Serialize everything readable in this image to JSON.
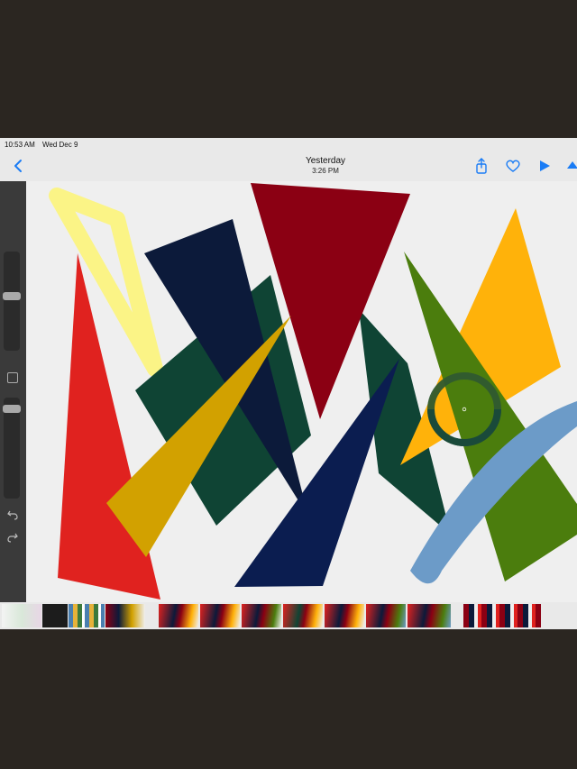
{
  "status_bar": {
    "time": "10:53 AM",
    "date": "Wed Dec 9"
  },
  "nav": {
    "title": "Yesterday",
    "subtitle": "3:26 PM",
    "icons": [
      "chevron-left-icon",
      "share-icon",
      "heart-icon",
      "play-icon",
      "procreate-icon"
    ],
    "accent_color": "#1a7cf5"
  },
  "artwork_colors": {
    "red": "#e0221f",
    "pale_yellow": "#fbf486",
    "navy": "#0c1a3a",
    "dark_green": "#0f4434",
    "crimson": "#8b0013",
    "gold": "#d2a100",
    "amber": "#ffb20a",
    "olive_green": "#4b7d0d",
    "royal_navy": "#0b1d50",
    "sky_blue": "#6c9bc8"
  },
  "filmstrip": {
    "frame_count": 16
  }
}
